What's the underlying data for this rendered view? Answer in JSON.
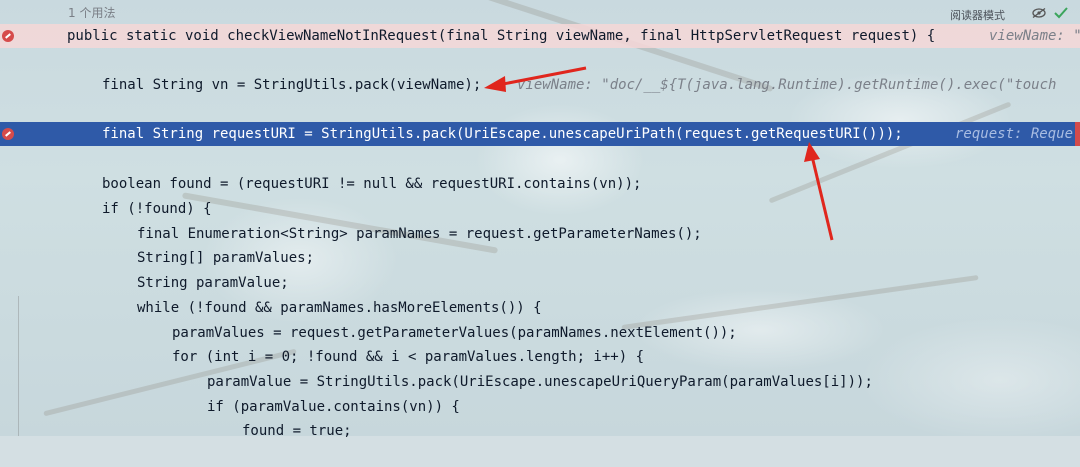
{
  "editor": {
    "usage_hint": "1 个用法",
    "reader_mode": "阅读器模式",
    "icons": [
      "eye-off-icon",
      "check-icon",
      "breakpoint-icon"
    ]
  },
  "colors": {
    "keyword": "#1c2fa6",
    "highlight_line": "#2f5aa8",
    "annotation_arrow": "#e0261d",
    "breakpoint": "#d64b4b"
  },
  "code": {
    "line1_code": "public static void checkViewNameNotInRequest(final String viewName, final HttpServletRequest request) {",
    "line1_hint": "viewName: \"doc",
    "line2_code": "final String vn = StringUtils.pack(viewName);",
    "line2_hint": "viewName: \"doc/__${T(java.lang.Runtime).getRuntime().exec(\"touch",
    "line3_code": "final String requestURI = StringUtils.pack(UriEscape.unescapeUriPath(request.getRequestURI()));",
    "line3_hint": "request: Reque",
    "line4": "boolean found = (requestURI != null && requestURI.contains(vn));",
    "line5": "if (!found) {",
    "line6": "final Enumeration<String> paramNames = request.getParameterNames();",
    "line7": "String[] paramValues;",
    "line8": "String paramValue;",
    "line9": "while (!found && paramNames.hasMoreElements()) {",
    "line10": "paramValues = request.getParameterValues(paramNames.nextElement());",
    "line11": "for (int i = 0; !found && i < paramValues.length; i++) {",
    "line12": "paramValue = StringUtils.pack(UriEscape.unescapeUriQueryParam(paramValues[i]));",
    "line13": "if (paramValue.contains(vn)) {",
    "line14": "found = true;"
  }
}
